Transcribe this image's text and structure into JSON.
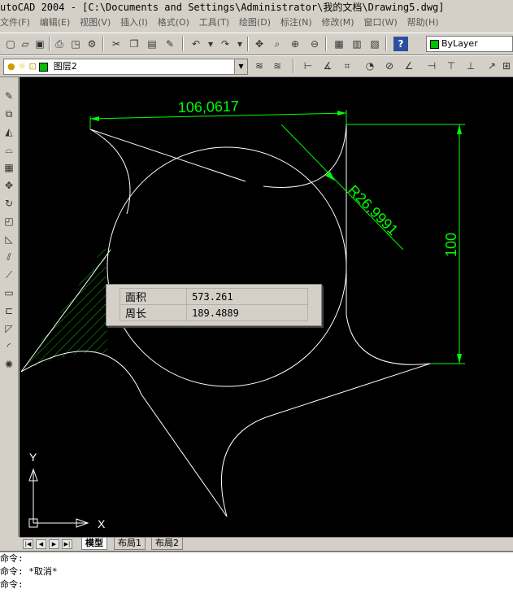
{
  "window": {
    "title": "utoCAD 2004 - [C:\\Documents and Settings\\Administrator\\我的文档\\Drawing5.dwg]"
  },
  "menu": [
    "文件(F)",
    "编辑(E)",
    "视图(V)",
    "插入(I)",
    "格式(O)",
    "工具(T)",
    "绘图(D)",
    "标注(N)",
    "修改(M)",
    "窗口(W)",
    "帮助(H)"
  ],
  "toolbar": {
    "color_combo": "ByLayer",
    "layer_combo": "图层2"
  },
  "drawing": {
    "dim_horizontal": "106,0617",
    "dim_radius": "R26,9991",
    "dim_vertical": "100",
    "ucs_x": "X",
    "ucs_y": "Y"
  },
  "info_popup": {
    "rows": [
      {
        "label": "面积",
        "value": "573.261"
      },
      {
        "label": "周长",
        "value": "189.4889"
      }
    ]
  },
  "tabs": [
    "模型",
    "布局1",
    "布局2"
  ],
  "command_lines": [
    "命令:",
    "命令: *取消*",
    "命令:"
  ],
  "colors": {
    "canvas_bg": "#000000",
    "geometry": "#ffffff",
    "dimension": "#00ff00"
  }
}
